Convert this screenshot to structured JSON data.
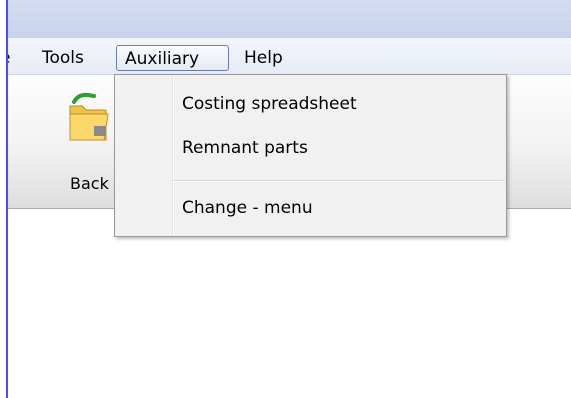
{
  "menubar": {
    "partial_label": "e",
    "items": [
      {
        "label": "Tools"
      },
      {
        "label": "Auxiliary"
      },
      {
        "label": "Help"
      }
    ]
  },
  "toolbar": {
    "back_label": "Back"
  },
  "dropdown": {
    "items": [
      {
        "label": "Costing spreadsheet"
      },
      {
        "label": "Remnant parts"
      },
      {
        "label": "Change - menu"
      }
    ]
  },
  "icons": {
    "back": "folder-back-icon"
  }
}
